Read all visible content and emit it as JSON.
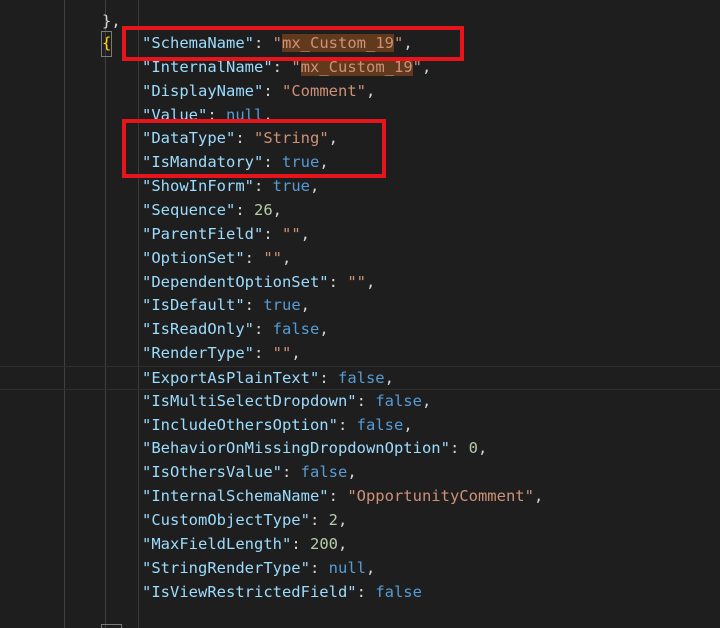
{
  "editor": {
    "top_fragment": "},",
    "open_brace": "{",
    "close_brace": "},",
    "lines": [
      {
        "key": "\"SchemaName\"",
        "value": "\"mx_Custom_19\"",
        "type": "string",
        "highlight": true
      },
      {
        "key": "\"InternalName\"",
        "value": "\"mx_Custom_19\"",
        "type": "string",
        "highlight": true
      },
      {
        "key": "\"DisplayName\"",
        "value": "\"Comment\"",
        "type": "string"
      },
      {
        "key": "\"Value\"",
        "value": "null",
        "type": "keyword"
      },
      {
        "key": "\"DataType\"",
        "value": "\"String\"",
        "type": "string"
      },
      {
        "key": "\"IsMandatory\"",
        "value": "true",
        "type": "keyword"
      },
      {
        "key": "\"ShowInForm\"",
        "value": "true",
        "type": "keyword"
      },
      {
        "key": "\"Sequence\"",
        "value": "26",
        "type": "number"
      },
      {
        "key": "\"ParentField\"",
        "value": "\"\"",
        "type": "string"
      },
      {
        "key": "\"OptionSet\"",
        "value": "\"\"",
        "type": "string"
      },
      {
        "key": "\"DependentOptionSet\"",
        "value": "\"\"",
        "type": "string"
      },
      {
        "key": "\"IsDefault\"",
        "value": "true",
        "type": "keyword"
      },
      {
        "key": "\"IsReadOnly\"",
        "value": "false",
        "type": "keyword"
      },
      {
        "key": "\"RenderType\"",
        "value": "\"\"",
        "type": "string"
      },
      {
        "key": "\"ExportAsPlainText\"",
        "value": "false",
        "type": "keyword",
        "current": true
      },
      {
        "key": "\"IsMultiSelectDropdown\"",
        "value": "false",
        "type": "keyword"
      },
      {
        "key": "\"IncludeOthersOption\"",
        "value": "false",
        "type": "keyword"
      },
      {
        "key": "\"BehaviorOnMissingDropdownOption\"",
        "value": "0",
        "type": "number"
      },
      {
        "key": "\"IsOthersValue\"",
        "value": "false",
        "type": "keyword"
      },
      {
        "key": "\"InternalSchemaName\"",
        "value": "\"OpportunityComment\"",
        "type": "string"
      },
      {
        "key": "\"CustomObjectType\"",
        "value": "2",
        "type": "number"
      },
      {
        "key": "\"MaxFieldLength\"",
        "value": "200",
        "type": "number"
      },
      {
        "key": "\"StringRenderType\"",
        "value": "null",
        "type": "keyword"
      },
      {
        "key": "\"IsViewRestrictedField\"",
        "value": "false",
        "type": "keyword",
        "last": true
      }
    ]
  },
  "colors": {
    "background": "#1e1e1e",
    "key": "#9cdcfe",
    "string": "#ce9178",
    "number": "#b5cea8",
    "keyword": "#569cd6",
    "punctuation": "#d4d4d4",
    "find_highlight": "#613a1e",
    "annotation_box": "#e8141c"
  }
}
